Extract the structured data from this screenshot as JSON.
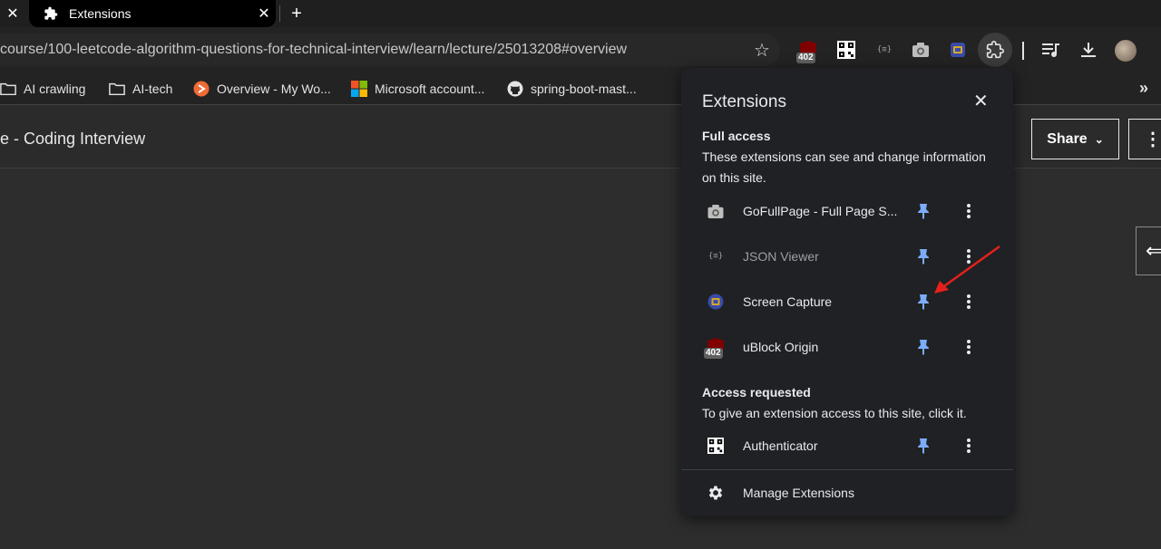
{
  "tab": {
    "title": "Extensions"
  },
  "toolbar": {
    "url": "course/100-leetcode-algorithm-questions-for-technical-interview/learn/lecture/25013208#overview",
    "ublock_badge": "402"
  },
  "bookmarks": [
    {
      "label": "AI crawling",
      "icon": "folder-icon"
    },
    {
      "label": "AI-tech",
      "icon": "folder-icon"
    },
    {
      "label": "Overview - My Wo...",
      "icon": "overview-icon"
    },
    {
      "label": "Microsoft account...",
      "icon": "microsoft-icon"
    },
    {
      "label": "spring-boot-mast...",
      "icon": "github-icon"
    }
  ],
  "page": {
    "title": "e - Coding Interview",
    "share_label": "Share"
  },
  "extensions_popup": {
    "title": "Extensions",
    "full_access": {
      "heading": "Full access",
      "description": "These extensions can see and change information on this site.",
      "items": [
        {
          "name": "GoFullPage - Full Page S...",
          "icon": "camera-icon"
        },
        {
          "name": "JSON Viewer",
          "icon": "json-icon"
        },
        {
          "name": "Screen Capture",
          "icon": "screen-capture-icon"
        },
        {
          "name": "uBlock Origin",
          "icon": "ublock-icon",
          "badge": "402"
        }
      ]
    },
    "access_requested": {
      "heading": "Access requested",
      "description": "To give an extension access to this site, click it.",
      "items": [
        {
          "name": "Authenticator",
          "icon": "qr-code-icon"
        }
      ]
    },
    "manage_label": "Manage Extensions"
  },
  "colors": {
    "pin_blue": "#7cacf8",
    "popup_bg": "#1f2124",
    "annotation_red": "#e5201b"
  }
}
